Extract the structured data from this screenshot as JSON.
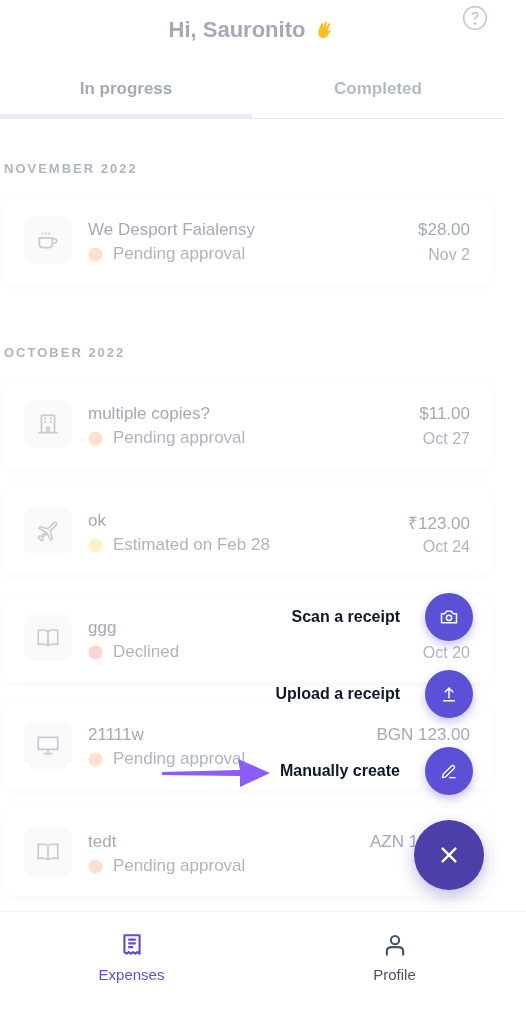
{
  "header": {
    "greeting": "Hi, Sauronito"
  },
  "tabs": [
    {
      "label": "In progress",
      "selected": true
    },
    {
      "label": "Completed",
      "selected": false
    }
  ],
  "sections": [
    {
      "title": "NOVEMBER 2022",
      "expenses": [
        {
          "kind": "cup",
          "name": "We Desport Faialensy",
          "status": "Pending approval",
          "color": "#fde0d0",
          "amount": "$28.00",
          "date": "Nov 2"
        }
      ]
    },
    {
      "title": "OCTOBER 2022",
      "expenses": [
        {
          "kind": "building",
          "name": "multiple copies?",
          "status": "Pending approval",
          "color": "#fde0d0",
          "amount": "$11.00",
          "date": "Oct 27"
        },
        {
          "kind": "plane",
          "name": "ok",
          "status": "Estimated on Feb 28",
          "color": "#fdf1c8",
          "amount": "₹123.00",
          "date": "Oct 24"
        },
        {
          "kind": "book",
          "name": "ggg",
          "status": "Declined",
          "color": "#fcd4d4",
          "date": "Oct 20"
        },
        {
          "kind": "monitor",
          "name": "21111w",
          "status": "Pending approval",
          "color": "#fde0d0",
          "amount": "BGN 123.00"
        },
        {
          "kind": "book",
          "name": "tedt",
          "status": "Pending approval",
          "color": "#fde0d0",
          "amount": "AZN 1"
        }
      ]
    }
  ],
  "menu": [
    {
      "kind": "camera",
      "label": "Scan a receipt"
    },
    {
      "kind": "upload",
      "label": "Upload a receipt"
    },
    {
      "kind": "pencil",
      "label": "Manually create"
    }
  ],
  "nav": [
    {
      "kind": "receipt",
      "label": "Expenses",
      "selected": true
    },
    {
      "kind": "person",
      "label": "Profile",
      "selected": false
    }
  ]
}
